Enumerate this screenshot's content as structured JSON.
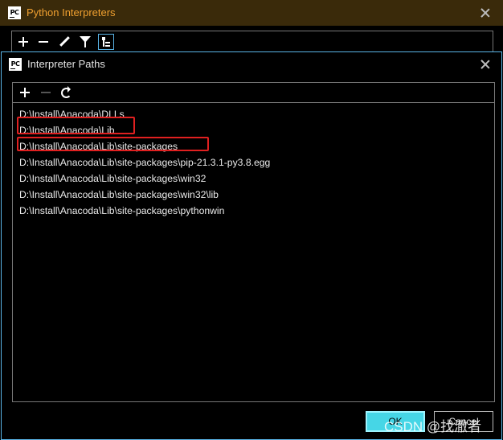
{
  "outer_window": {
    "logo_text": "PC",
    "title": "Python Interpreters",
    "title_color": "#f0a030"
  },
  "dialog": {
    "logo_text": "PC",
    "title": "Interpreter Paths",
    "paths": [
      "D:\\Install\\Anacoda\\DLLs",
      "D:\\Install\\Anacoda\\Lib",
      "D:\\Install\\Anacoda\\Lib\\site-packages",
      "D:\\Install\\Anacoda\\Lib\\site-packages\\pip-21.3.1-py3.8.egg",
      "D:\\Install\\Anacoda\\Lib\\site-packages\\win32",
      "D:\\Install\\Anacoda\\Lib\\site-packages\\win32\\lib",
      "D:\\Install\\Anacoda\\Lib\\site-packages\\pythonwin"
    ],
    "ok_label": "OK",
    "cancel_label": "Cancel"
  },
  "watermark": "CSDN @找澈者",
  "colors": {
    "accent": "#5ab4e6",
    "ok_button": "#46d6e6",
    "highlight": "#e02020"
  }
}
